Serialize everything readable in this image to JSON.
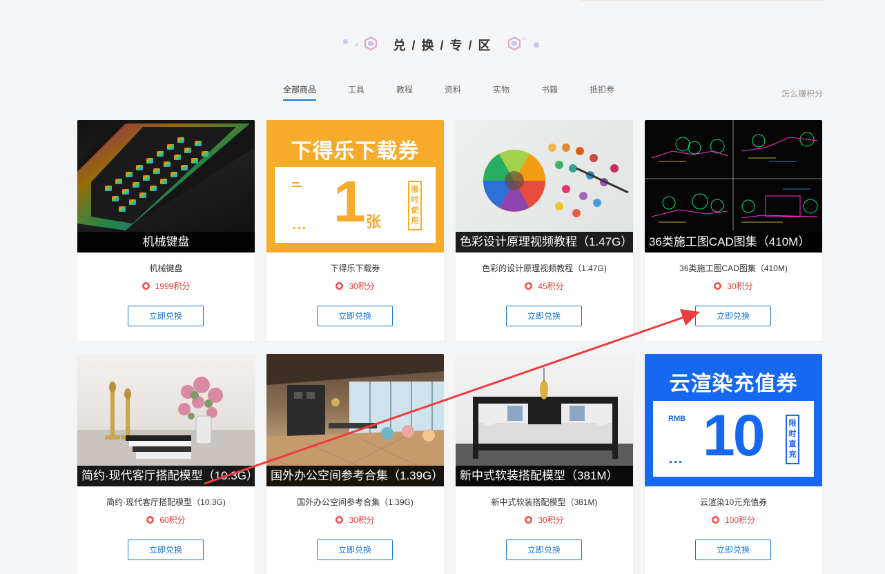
{
  "section": {
    "title": "兑 / 换 / 专 / 区"
  },
  "tabs": [
    {
      "label": "全部商品",
      "active": true
    },
    {
      "label": "工具",
      "active": false
    },
    {
      "label": "教程",
      "active": false
    },
    {
      "label": "资料",
      "active": false
    },
    {
      "label": "实物",
      "active": false
    },
    {
      "label": "书籍",
      "active": false
    },
    {
      "label": "抵扣券",
      "active": false
    }
  ],
  "earn_link": "怎么赚积分",
  "products": [
    {
      "caption": "机械键盘",
      "name": "机械键盘",
      "price": "1999积分",
      "button": "立即兑换"
    },
    {
      "caption": "",
      "name": "下得乐下载券",
      "price": "30积分",
      "button": "立即兑换",
      "voucher": {
        "title": "下得乐下载券",
        "number": "1",
        "unit": "张",
        "tag": "限时使用"
      }
    },
    {
      "caption": "色彩设计原理视频教程（1.47G）",
      "name": "色彩的设计原理视频教程（1.47G)",
      "price": "45积分",
      "button": "立即兑换"
    },
    {
      "caption": "36类施工图CAD图集（410M）",
      "name": "36类施工图CAD图集（410M)",
      "price": "30积分",
      "button": "立即兑换"
    },
    {
      "caption": "简约·现代客厅搭配模型（10.3G）",
      "name": "简约·现代客厅搭配模型（10.3G)",
      "price": "60积分",
      "button": "立即兑换"
    },
    {
      "caption": "国外办公空间参考合集（1.39G）",
      "name": "国外办公空间参考合集（1.39G)",
      "price": "30积分",
      "button": "立即兑换"
    },
    {
      "caption": "新中式软装搭配模型（381M）",
      "name": "新中式软装搭配模型（381M)",
      "price": "30积分",
      "button": "立即兑换"
    },
    {
      "caption": "",
      "name": "云渲染10元充值券",
      "price": "100积分",
      "button": "立即兑换",
      "voucher": {
        "title": "云渲染充值券",
        "prefix": "RMB",
        "number": "10",
        "tag": "限时直充"
      }
    }
  ],
  "colors": {
    "accent": "#1677d2",
    "price": "#e53935",
    "annotation_arrow": "#ef3b3b",
    "voucher_orange": "#f6ab2a",
    "voucher_blue": "#1568ef"
  }
}
